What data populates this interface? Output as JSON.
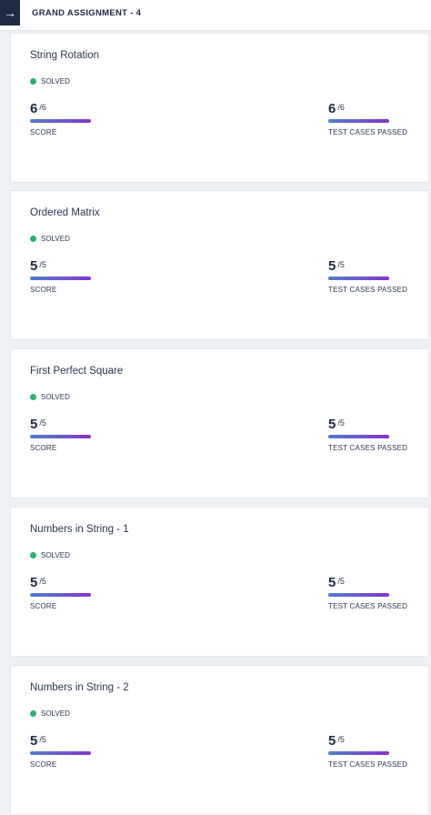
{
  "header": {
    "back_icon": "arrow-left-icon",
    "title": "GRAND ASSIGNMENT - 4"
  },
  "colors": {
    "dark": "#1e2b45",
    "solved_green": "#26b56e",
    "bar_gradient": [
      "#4f7fc9",
      "#6a5acd",
      "#8a2fd1"
    ]
  },
  "cards": [
    {
      "title": "String Rotation",
      "status": "SOLVED",
      "score": "6",
      "score_total": "/6",
      "score_label": "SCORE",
      "tests": "6",
      "tests_total": "/6",
      "tests_label": "TEST CASES PASSED"
    },
    {
      "title": "Ordered Matrix",
      "status": "SOLVED",
      "score": "5",
      "score_total": "/5",
      "score_label": "SCORE",
      "tests": "5",
      "tests_total": "/5",
      "tests_label": "TEST CASES PASSED"
    },
    {
      "title": "First Perfect Square",
      "status": "SOLVED",
      "score": "5",
      "score_total": "/5",
      "score_label": "SCORE",
      "tests": "5",
      "tests_total": "/5",
      "tests_label": "TEST CASES PASSED"
    },
    {
      "title": "Numbers in String - 1",
      "status": "SOLVED",
      "score": "5",
      "score_total": "/5",
      "score_label": "SCORE",
      "tests": "5",
      "tests_total": "/5",
      "tests_label": "TEST CASES PASSED"
    },
    {
      "title": "Numbers in String - 2",
      "status": "SOLVED",
      "score": "5",
      "score_total": "/5",
      "score_label": "SCORE",
      "tests": "5",
      "tests_total": "/5",
      "tests_label": "TEST CASES PASSED"
    }
  ]
}
